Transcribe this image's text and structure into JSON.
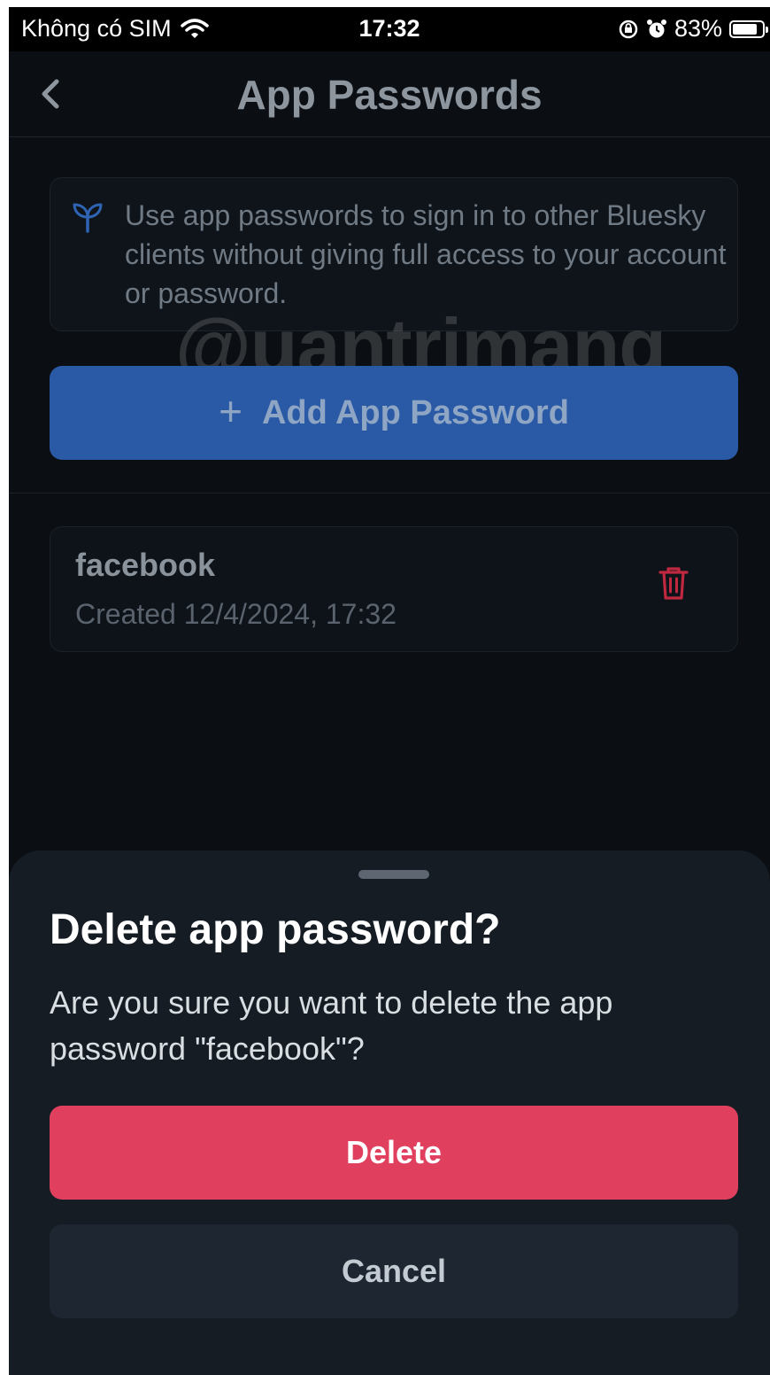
{
  "status_bar": {
    "carrier": "Không có SIM",
    "time": "17:32",
    "battery": "83%",
    "battery_level": 0.83
  },
  "header": {
    "title": "App Passwords"
  },
  "info": {
    "text": "Use app passwords to sign in to other Bluesky clients without giving full access to your account or password."
  },
  "watermark": "@uantrimang",
  "add_button": {
    "label": "Add App Password"
  },
  "passwords": [
    {
      "name": "facebook",
      "created": "Created 12/4/2024, 17:32"
    }
  ],
  "dialog": {
    "title": "Delete app password?",
    "message": "Are you sure you want to delete the app password \"facebook\"?",
    "delete_label": "Delete",
    "cancel_label": "Cancel"
  },
  "colors": {
    "primary": "#2a5aa6",
    "danger": "#e0405e",
    "background": "#0b0f14",
    "sheet": "#161c24"
  },
  "icons": [
    "wifi-icon",
    "lock-rotation-icon",
    "alarm-icon",
    "battery-icon",
    "back-chevron-icon",
    "sprout-icon",
    "plus-icon",
    "trash-icon"
  ]
}
